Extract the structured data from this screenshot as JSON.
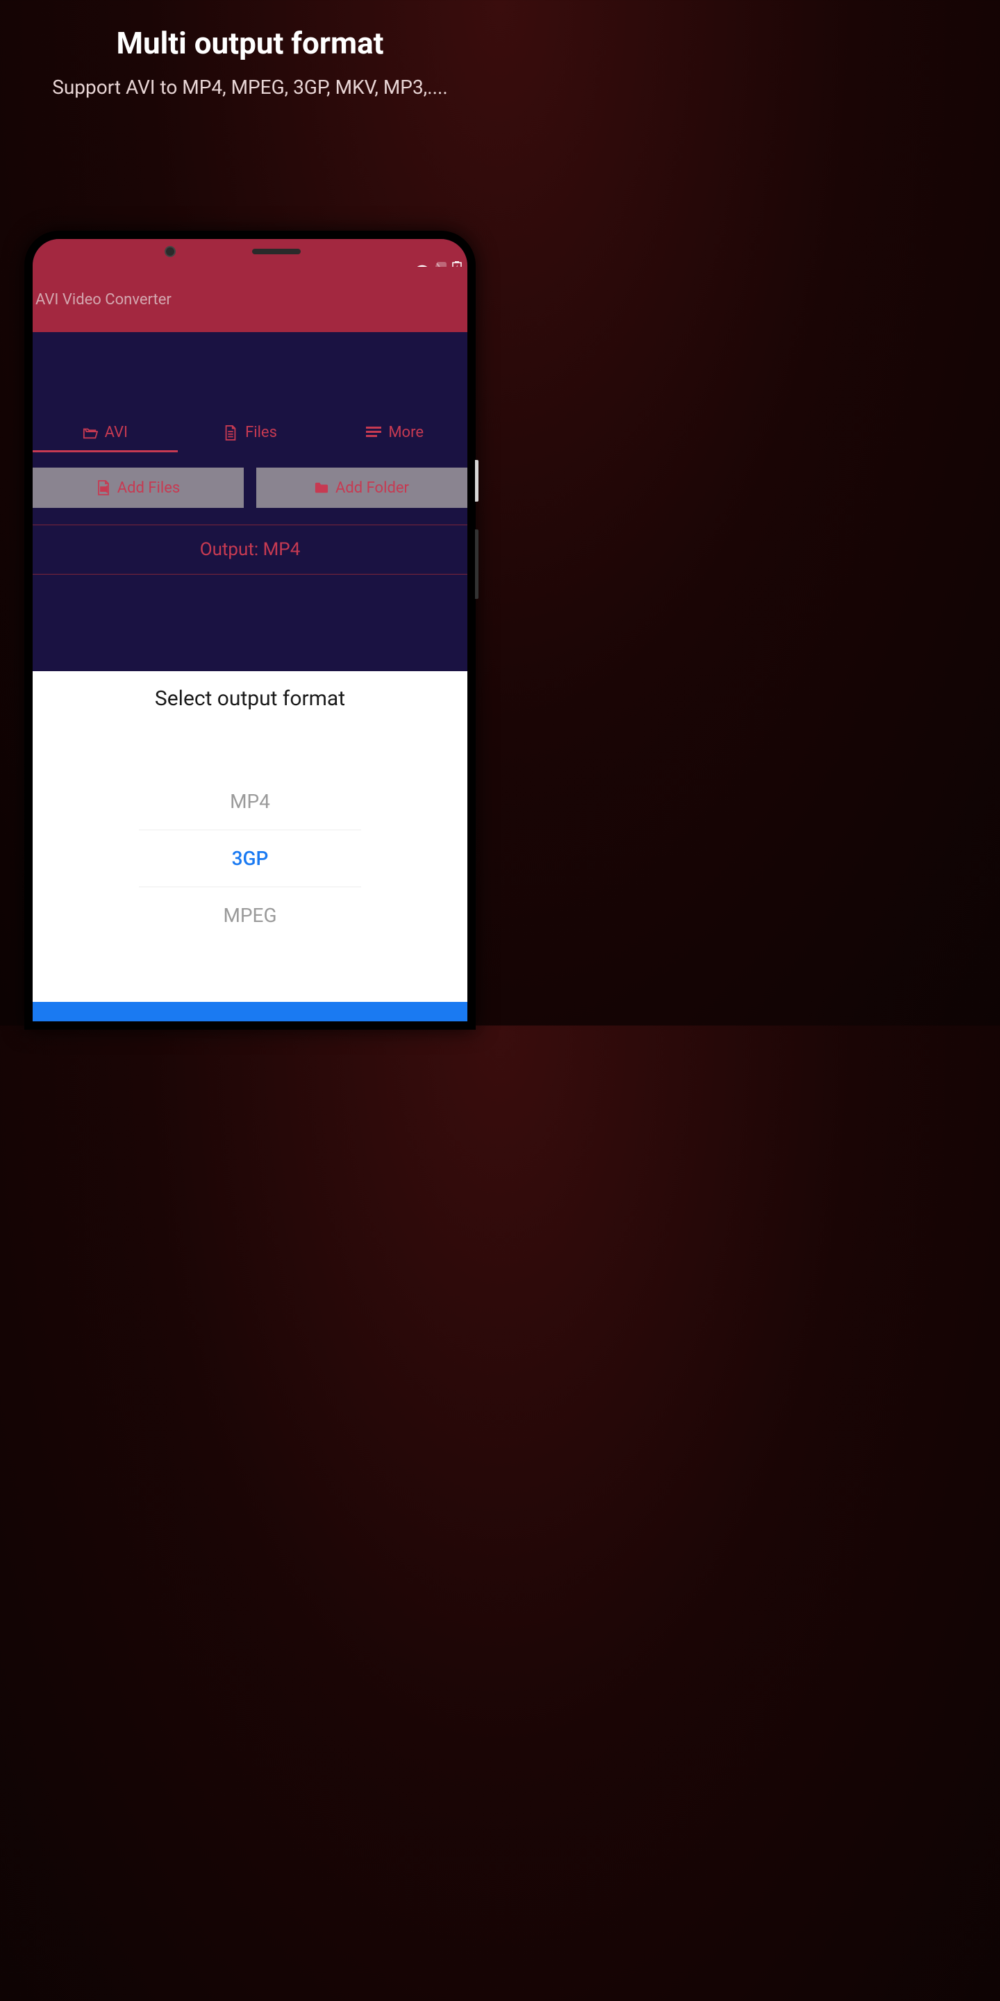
{
  "promo": {
    "title": "Multi output format",
    "subtitle": "Support AVI to MP4, MPEG, 3GP, MKV, MP3,...."
  },
  "app": {
    "title": "AVI Video Converter"
  },
  "tabs": [
    {
      "label": "AVI",
      "icon": "folder-open",
      "active": true
    },
    {
      "label": "Files",
      "icon": "file-text",
      "active": false
    },
    {
      "label": "More",
      "icon": "menu-lines",
      "active": false
    }
  ],
  "buttons": {
    "addFiles": "Add Files",
    "addFolder": "Add Folder"
  },
  "output": {
    "label": "Output: MP4"
  },
  "sheet": {
    "title": "Select output format",
    "options": [
      {
        "label": "MP4",
        "selected": false
      },
      {
        "label": "3GP",
        "selected": true
      },
      {
        "label": "MPEG",
        "selected": false
      }
    ]
  }
}
